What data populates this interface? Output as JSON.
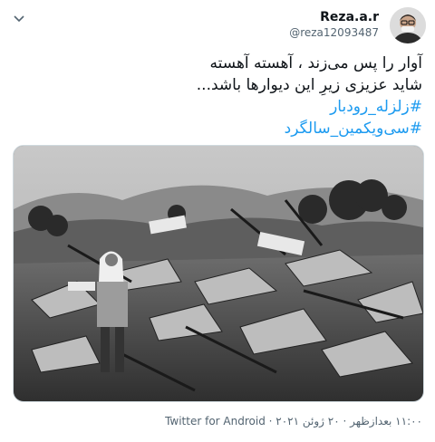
{
  "tweet": {
    "author": {
      "display_name": "Reza.a.r",
      "handle": "@reza12093487",
      "avatar_icon": "profile-photo"
    },
    "menu_icon": "chevron-down-icon",
    "text_lines": [
      "آوار را پس می‌زند ، آهسته آهسته",
      "شاید عزیزی زیرِ این دیوارها باشد..."
    ],
    "hashtags": [
      "#زلزله_رودبار",
      "#سی‌ویکمین_سالگرد"
    ],
    "media": {
      "type": "photo",
      "icon": "earthquake-rubble-photo"
    },
    "meta": {
      "time": "۱۱:۰۰ بعدازظهر",
      "date": "۲۰ ژوئن ۲۰۲۱",
      "separator": " · ",
      "source": "Twitter for Android"
    },
    "colors": {
      "link": "#1d9bf0",
      "text": "#0f1419",
      "muted": "#536471"
    }
  }
}
